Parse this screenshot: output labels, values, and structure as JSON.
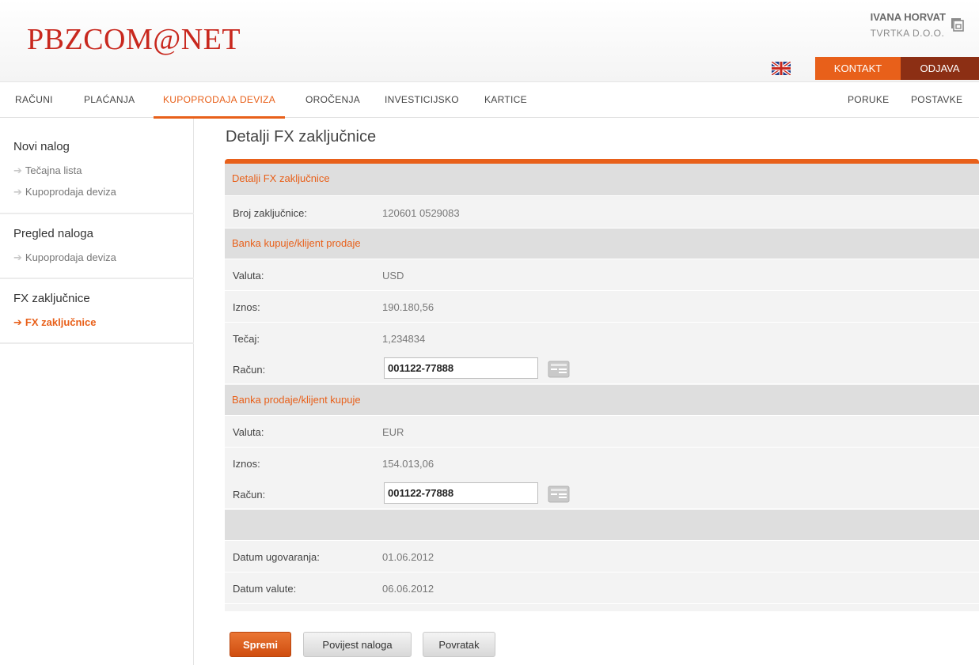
{
  "header": {
    "logo": "PBZCOM@NET",
    "user_name": "IVANA HORVAT",
    "company": "TVRTKA D.O.O.",
    "contact_label": "KONTAKT",
    "logout_label": "ODJAVA",
    "icons": {
      "logout": "logout-icon",
      "language": "uk-flag-icon"
    }
  },
  "nav": {
    "items": [
      "RAČUNI",
      "PLAĆANJA",
      "KUPOPRODAJA DEVIZA",
      "OROČENJA",
      "INVESTICIJSKO",
      "KARTICE"
    ],
    "active": "KUPOPRODAJA DEVIZA",
    "right_items": [
      "PORUKE",
      "POSTAVKE"
    ]
  },
  "sidebar": {
    "sections": [
      {
        "title": "Novi nalog",
        "links": [
          "Tečajna lista",
          "Kupoprodaja deviza"
        ]
      },
      {
        "title": "Pregled naloga",
        "links": [
          "Kupoprodaja deviza"
        ]
      },
      {
        "title": "FX zaključnice",
        "links": [
          "FX zaključnice"
        ]
      }
    ],
    "active_link": "FX zaključnice"
  },
  "main": {
    "page_title": "Detalji FX zaključnice",
    "details_header": "Detalji FX zaključnice",
    "deal_number_label": "Broj zaključnice:",
    "deal_number": "120601 0529083",
    "buy": {
      "header": "Banka kupuje/klijent prodaje",
      "currency_label": "Valuta:",
      "currency": "USD",
      "amount_label": "Iznos:",
      "amount": "190.180,56",
      "rate_label": "Tečaj:",
      "rate": "1,234834",
      "account_label": "Račun:",
      "account": "001122-77888"
    },
    "sell": {
      "header": "Banka prodaje/klijent kupuje",
      "currency_label": "Valuta:",
      "currency": "EUR",
      "amount_label": "Iznos:",
      "amount": "154.013,06",
      "account_label": "Račun:",
      "account": "001122-77888"
    },
    "contract_date_label": "Datum ugovaranja:",
    "contract_date": "01.06.2012",
    "value_date_label": "Datum valute:",
    "value_date": "06.06.2012"
  },
  "buttons": {
    "save": "Spremi",
    "history": "Povijest naloga",
    "back": "Povratak"
  },
  "colors": {
    "accent": "#e8601a",
    "logo": "#c8281e",
    "logout_bg": "#8c2f14"
  }
}
